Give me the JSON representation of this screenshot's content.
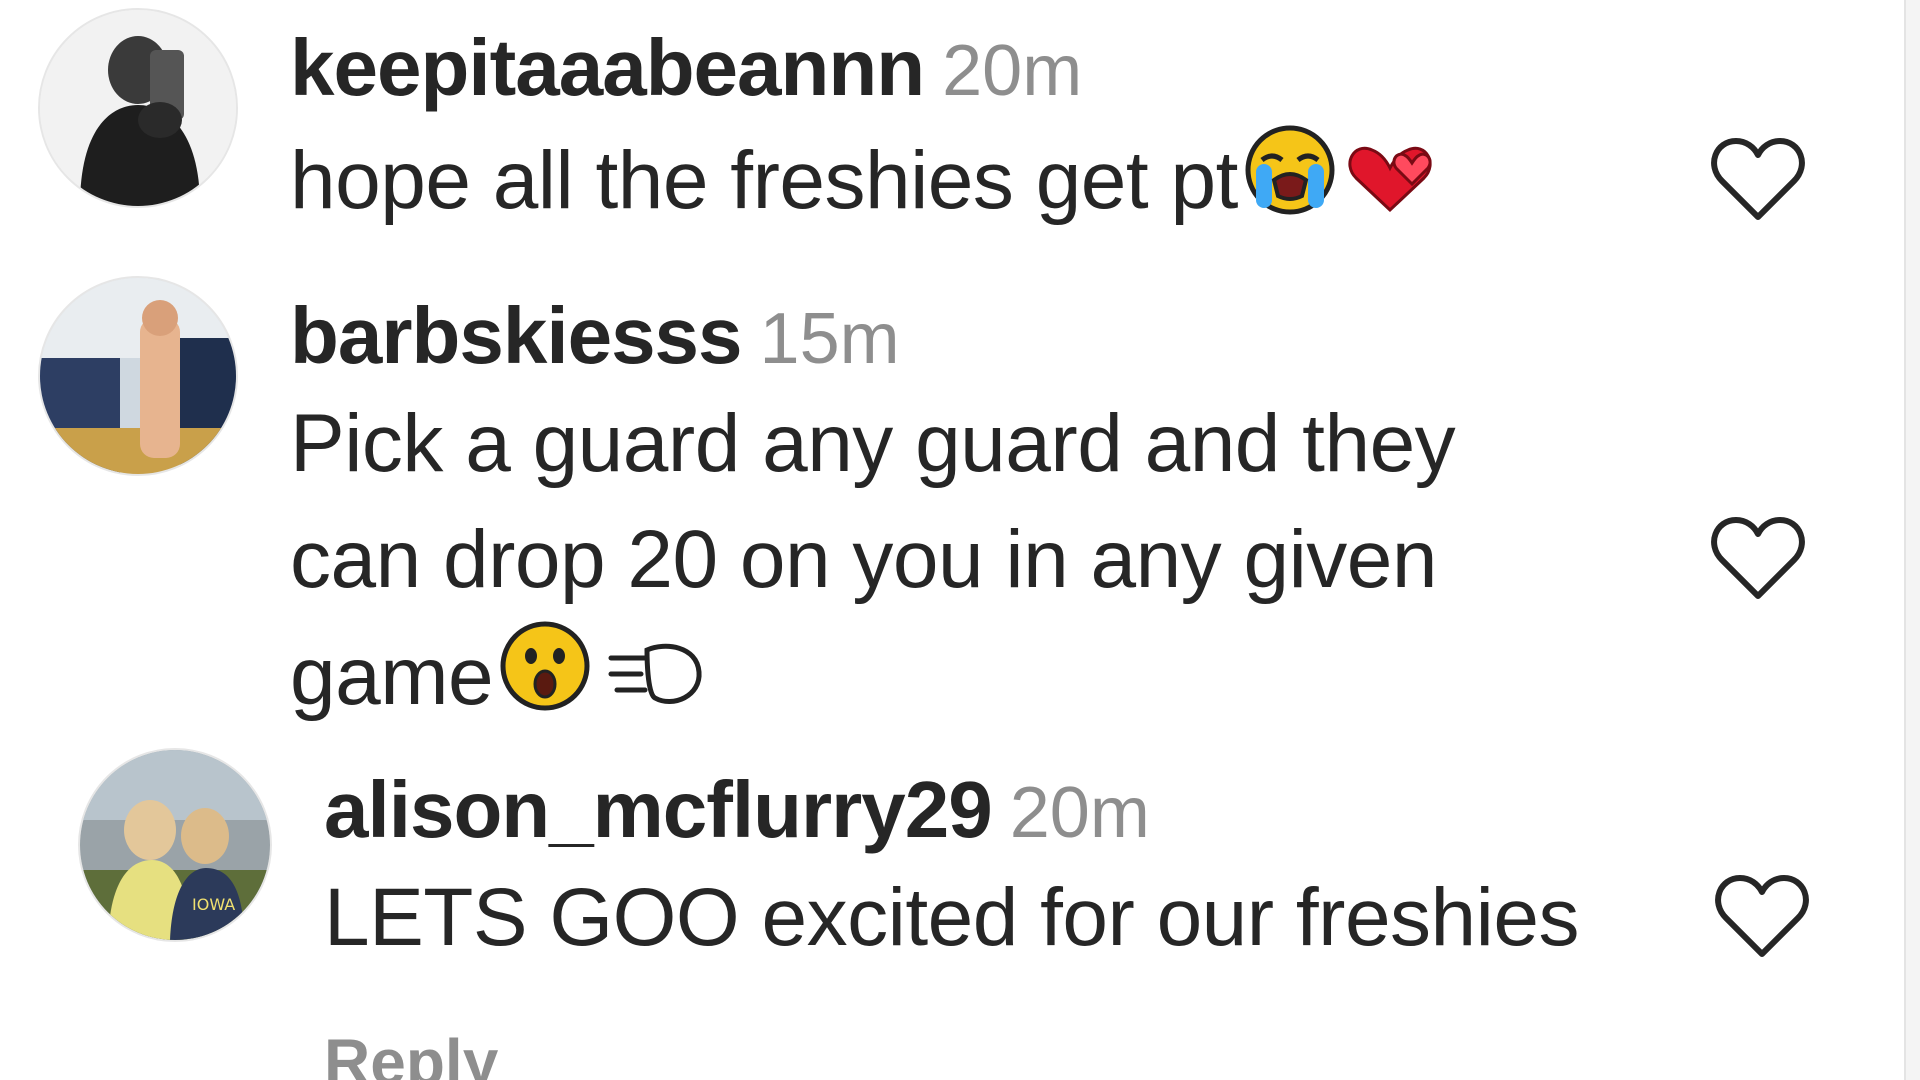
{
  "comments": [
    {
      "username": "keepitaaabeannn",
      "time": "20m",
      "text_lines": [
        "hope all the freshies get pt"
      ],
      "emojis": [
        "loudly-crying-face-emoji",
        "two-hearts-emoji"
      ],
      "like_icon": "heart-outline-icon"
    },
    {
      "username": "barbskiesss",
      "time": "15m",
      "text_lines": [
        "Pick a guard any guard and they",
        "can drop 20 on you in any given",
        "game"
      ],
      "emojis": [
        "astonished-face-emoji",
        "dashing-away-emoji"
      ],
      "like_icon": "heart-outline-icon"
    },
    {
      "username": "alison_mcflurry29",
      "time": "20m",
      "text_lines": [
        "LETS GOO excited for our freshies"
      ],
      "emojis": [],
      "like_icon": "heart-outline-icon"
    }
  ],
  "reply_label": "Reply",
  "colors": {
    "text": "#262626",
    "muted": "#8e8e8e",
    "heart_stroke": "#262626",
    "emoji_yellow": "#f5c518",
    "emoji_tear": "#3fa9f5",
    "emoji_heart": "#e0162b"
  }
}
